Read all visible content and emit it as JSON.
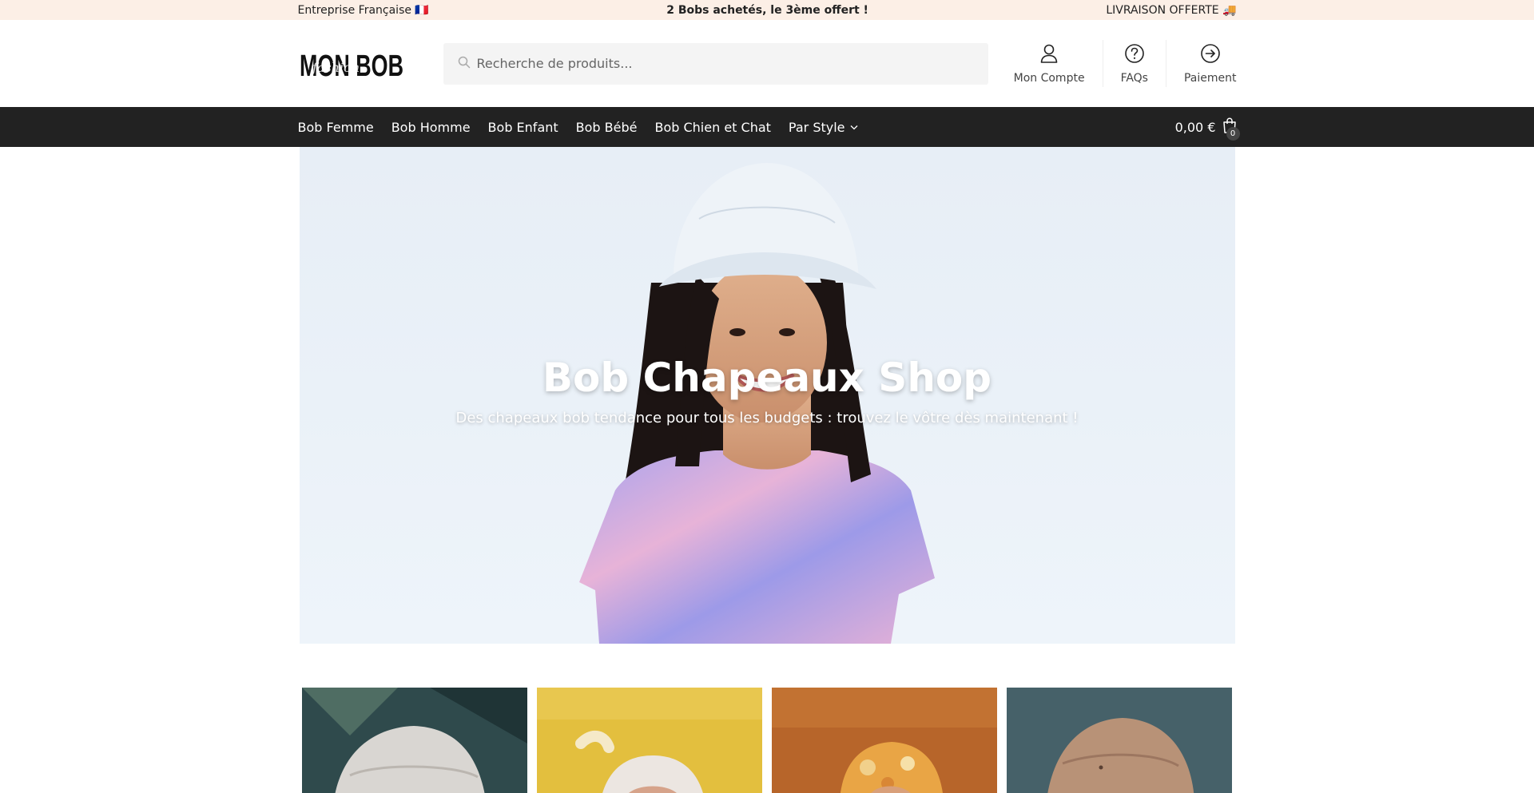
{
  "topbar": {
    "left": "Entreprise Française 🇫🇷",
    "center": "2 Bobs achetés, le 3ème offert !",
    "right": "LIVRAISON OFFERTE 🚚"
  },
  "header": {
    "logo_text": "MON BOB",
    "logo_script": "fashion",
    "search_placeholder": "Recherche de produits...",
    "links": [
      {
        "label": "Mon Compte",
        "icon": "user-icon"
      },
      {
        "label": "FAQs",
        "icon": "question-icon"
      },
      {
        "label": "Paiement",
        "icon": "arrow-circle-icon"
      }
    ]
  },
  "nav": {
    "items": [
      "Bob Femme",
      "Bob Homme",
      "Bob Enfant",
      "Bob Bébé",
      "Bob Chien et Chat"
    ],
    "dropdown": "Par Style",
    "cart_total": "0,00 €",
    "cart_count": "0"
  },
  "hero": {
    "title": "Bob Chapeaux Shop",
    "subtitle": "Des chapeaux bob tendance pour tous les budgets : trouvez le vôtre dès maintenant !"
  },
  "colors": {
    "topbar_bg": "#fcefe6",
    "nav_bg": "#222222",
    "search_bg": "#f4f4f4"
  }
}
